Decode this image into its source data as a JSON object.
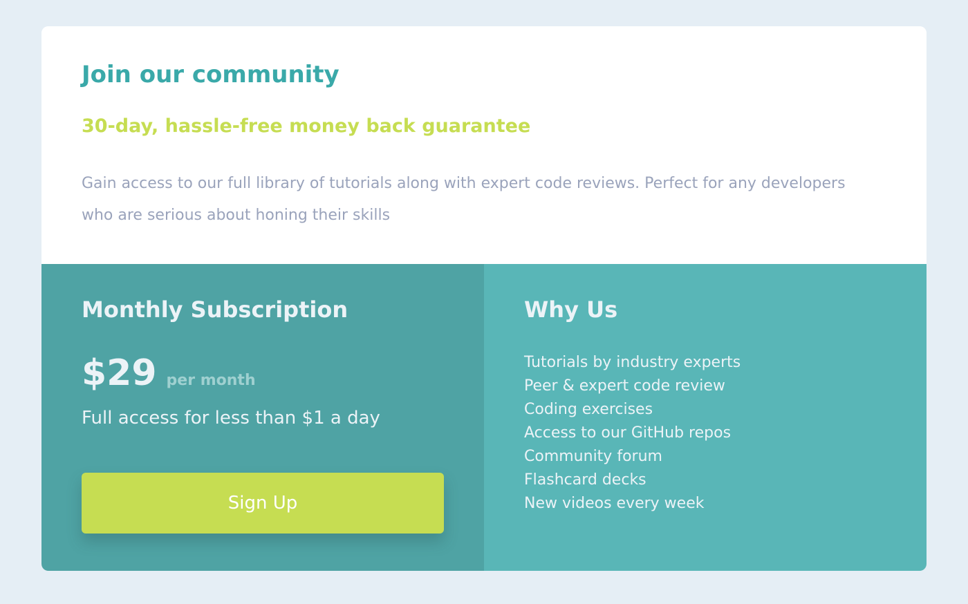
{
  "colors": {
    "page_background": "#e5eef5",
    "card_background": "#ffffff",
    "title_teal": "#3aa9a9",
    "accent_lime": "#c6dd52",
    "description_gray": "#9aa3bb",
    "subscription_panel": "#4fa3a4",
    "why_panel": "#59b6b7",
    "light_text": "#ecf3f7",
    "muted_teal_text": "#9fd0d0"
  },
  "header": {
    "title": "Join our community",
    "subtitle": "30-day, hassle-free money back guarantee",
    "description": "Gain access to our full library of tutorials along with expert code reviews. Perfect for any developers who are serious about honing their skills"
  },
  "subscription": {
    "title": "Monthly Subscription",
    "price": "$29",
    "period": "per month",
    "tagline": "Full access for less than $1 a day",
    "button_label": "Sign Up"
  },
  "why_us": {
    "title": "Why Us",
    "items": [
      "Tutorials by industry experts",
      "Peer & expert code review",
      "Coding exercises",
      "Access to our GitHub repos",
      "Community forum",
      "Flashcard decks",
      "New videos every week"
    ]
  }
}
